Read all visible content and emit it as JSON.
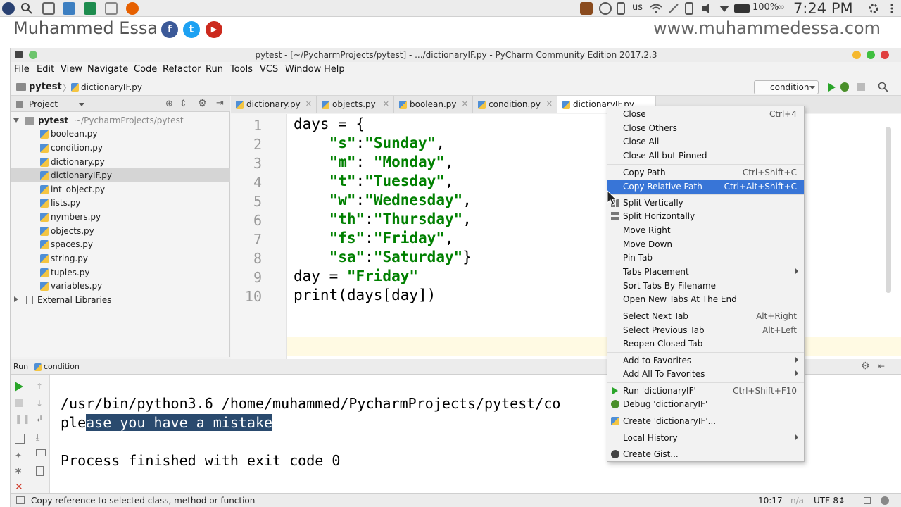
{
  "os": {
    "locale": "us",
    "battery": "100%",
    "battery_suffix": "∞",
    "clock": "7:24 PM"
  },
  "banner": {
    "name": "Muhammed Essa",
    "site": "www.muhammedessa.com",
    "social": [
      "f",
      "t",
      "▶"
    ]
  },
  "window": {
    "title": "pytest - [~/PycharmProjects/pytest] - .../dictionaryIF.py - PyCharm Community Edition 2017.2.3"
  },
  "menu": [
    "File",
    "Edit",
    "View",
    "Navigate",
    "Code",
    "Refactor",
    "Run",
    "Tools",
    "VCS",
    "Window",
    "Help"
  ],
  "navbar": {
    "project": "pytest",
    "file": "dictionaryIF.py",
    "run_config": "condition"
  },
  "project_panel": {
    "header": "Project",
    "root_name": "pytest",
    "root_path": "~/PycharmProjects/pytest",
    "files": [
      "boolean.py",
      "condition.py",
      "dictionary.py",
      "dictionaryIF.py",
      "int_object.py",
      "lists.py",
      "nymbers.py",
      "objects.py",
      "spaces.py",
      "string.py",
      "tuples.py",
      "variables.py"
    ],
    "selected": "dictionaryIF.py",
    "external": "External Libraries"
  },
  "tabs": [
    "dictionary.py",
    "objects.py",
    "boolean.py",
    "condition.py",
    "dictionaryIF.py"
  ],
  "editor": {
    "line_numbers": [
      "1",
      "2",
      "3",
      "4",
      "5",
      "6",
      "7",
      "8",
      "9",
      "10"
    ],
    "lines": {
      "l1": "days = {",
      "l2a": "    ",
      "l2k": "\"s\"",
      "l2c": ":",
      "l2v": "\"Sunday\"",
      "l2e": ",",
      "l3a": "    ",
      "l3k": "\"m\"",
      "l3c": ": ",
      "l3v": "\"Monday\"",
      "l3e": ",",
      "l4a": "    ",
      "l4k": "\"t\"",
      "l4c": ":",
      "l4v": "\"Tuesday\"",
      "l4e": ",",
      "l5a": "    ",
      "l5k": "\"w\"",
      "l5c": ":",
      "l5v": "\"Wednesday\"",
      "l5e": ",",
      "l6a": "    ",
      "l6k": "\"th\"",
      "l6c": ":",
      "l6v": "\"Thursday\"",
      "l6e": ",",
      "l7a": "    ",
      "l7k": "\"fs\"",
      "l7c": ":",
      "l7v": "\"Friday\"",
      "l7e": ",",
      "l8a": "    ",
      "l8k": "\"sa\"",
      "l8c": ":",
      "l8v": "\"Saturday\"",
      "l8e": "}",
      "l9a": "day = ",
      "l9v": "\"Friday\"",
      "l10": "print(days[day])"
    }
  },
  "run_panel": {
    "label": "Run",
    "config": "condition",
    "cmd": "/usr/bin/python3.6 /home/muhammed/PycharmProjects/pytest/co",
    "out_pre": "ple",
    "out_sel": "ase you have a mistake",
    "exit": "Process finished with exit code 0"
  },
  "status": {
    "message": "Copy reference to selected class, method or function",
    "position": "10:17",
    "na": "n/a",
    "encoding": "UTF-8↕"
  },
  "context_menu": {
    "items": [
      {
        "label": "Close",
        "shortcut": "Ctrl+4"
      },
      {
        "label": "Close Others",
        "shortcut": ""
      },
      {
        "label": "Close All",
        "shortcut": ""
      },
      {
        "label": "Close All but Pinned",
        "shortcut": ""
      },
      {
        "label": "Copy Path",
        "shortcut": "Ctrl+Shift+C"
      },
      {
        "label": "Copy Relative Path",
        "shortcut": "Ctrl+Alt+Shift+C"
      },
      {
        "label": "Split Vertically",
        "shortcut": ""
      },
      {
        "label": "Split Horizontally",
        "shortcut": ""
      },
      {
        "label": "Move Right",
        "shortcut": ""
      },
      {
        "label": "Move Down",
        "shortcut": ""
      },
      {
        "label": "Pin Tab",
        "shortcut": ""
      },
      {
        "label": "Tabs Placement",
        "shortcut": ""
      },
      {
        "label": "Sort Tabs By Filename",
        "shortcut": ""
      },
      {
        "label": "Open New Tabs At The End",
        "shortcut": ""
      },
      {
        "label": "Select Next Tab",
        "shortcut": "Alt+Right"
      },
      {
        "label": "Select Previous Tab",
        "shortcut": "Alt+Left"
      },
      {
        "label": "Reopen Closed Tab",
        "shortcut": ""
      },
      {
        "label": "Add to Favorites",
        "shortcut": ""
      },
      {
        "label": "Add All To Favorites",
        "shortcut": ""
      },
      {
        "label": "Run 'dictionaryIF'",
        "shortcut": "Ctrl+Shift+F10"
      },
      {
        "label": "Debug 'dictionaryIF'",
        "shortcut": ""
      },
      {
        "label": "Create 'dictionaryIF'...",
        "shortcut": ""
      },
      {
        "label": "Local History",
        "shortcut": ""
      },
      {
        "label": "Create Gist...",
        "shortcut": ""
      }
    ],
    "highlighted": "Copy Relative Path"
  },
  "colors": {
    "accent_highlight": "#3875d7",
    "string_green": "#008000",
    "run_green": "#2aa52a",
    "stop_red": "#d03a2a"
  }
}
